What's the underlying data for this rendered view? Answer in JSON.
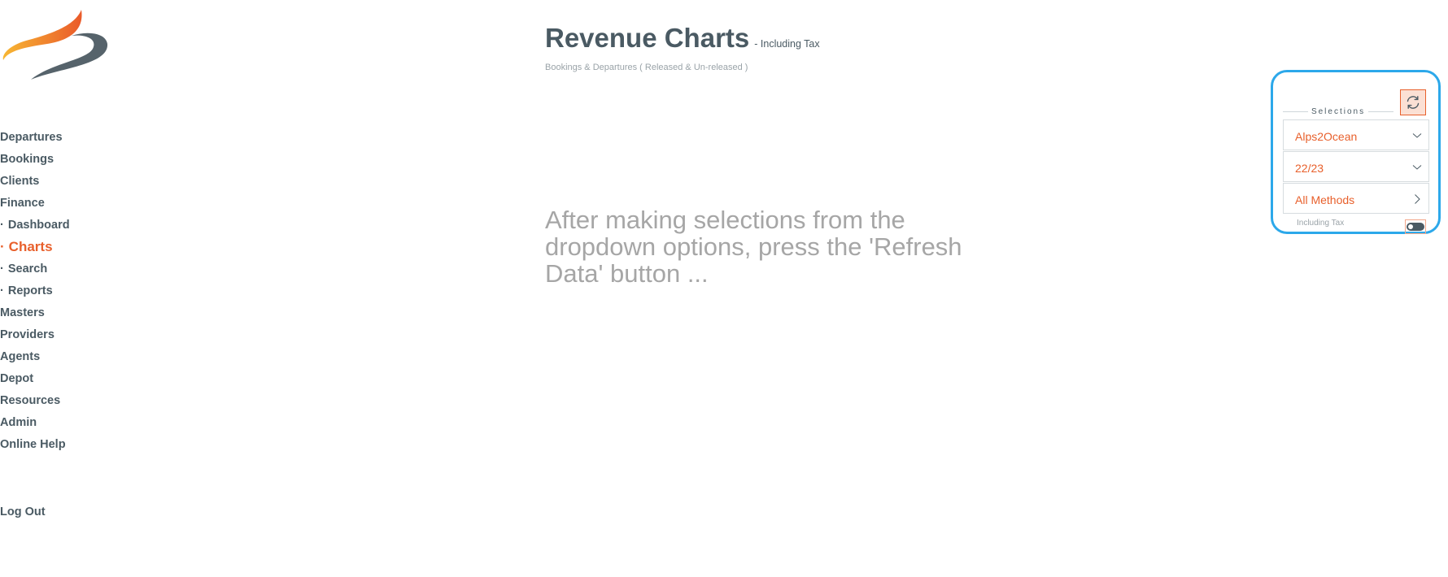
{
  "nav": [
    {
      "label": "Departures"
    },
    {
      "label": "Bookings"
    },
    {
      "label": "Clients"
    },
    {
      "label": "Finance"
    },
    {
      "label": "Dashboard",
      "prefix": "·"
    },
    {
      "label": "Charts",
      "prefix": "·",
      "active": true
    },
    {
      "label": "Search",
      "prefix": "·"
    },
    {
      "label": "Reports",
      "prefix": "·"
    },
    {
      "label": "Masters"
    },
    {
      "label": "Providers"
    },
    {
      "label": "Agents"
    },
    {
      "label": "Depot"
    },
    {
      "label": "Resources"
    },
    {
      "label": "Admin"
    },
    {
      "label": "Online Help"
    }
  ],
  "logout_label": "Log Out",
  "header": {
    "title": "Revenue Charts",
    "title_suffix": "- Including Tax",
    "subtitle": "Bookings & Departures ( Released & Un-released )"
  },
  "placeholder_message": "After making selections from the dropdown options, press the 'Refresh Data' button ...",
  "selections": {
    "legend": "Selections",
    "refresh_icon": "refresh-icon",
    "company": "Alps2Ocean",
    "period": "22/23",
    "method": "All Methods",
    "tax_label": "Including Tax",
    "tax_toggle_on": false
  },
  "colors": {
    "accent": "#e8602c",
    "text": "#4a5a63",
    "panel_border": "#2ca8ea",
    "muted": "#a6a6a6"
  }
}
